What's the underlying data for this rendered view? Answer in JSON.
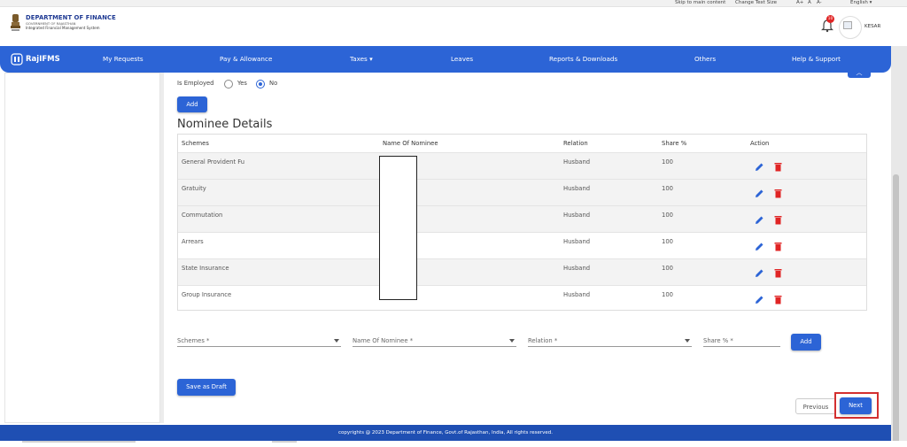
{
  "topbar": {
    "skip": "Skip to main content",
    "text_size": "Change Text Size",
    "a_plus": "A+",
    "a": "A",
    "a_minus": "A-",
    "language": "English"
  },
  "header": {
    "dept_title": "DEPARTMENT OF FINANCE",
    "dept_sub": "GOVERNMENT OF RAJASTHAN",
    "system_name": "Integrated Financial Management System",
    "notification_count": "10",
    "user_name": "KESAR"
  },
  "nav": {
    "brand": "RajIFMS",
    "items": [
      "My Requests",
      "Pay & Allowance",
      "Taxes",
      "Leaves",
      "Reports & Downloads",
      "Others",
      "Help & Support"
    ]
  },
  "form": {
    "employed_label": "Is Employed",
    "yes": "Yes",
    "no": "No",
    "add_label": "Add",
    "section_title": "Nominee Details"
  },
  "table": {
    "headers": [
      "Schemes",
      "Name Of Nominee",
      "Relation",
      "Share %",
      "Action"
    ],
    "rows": [
      {
        "scheme": "General Provident Fu",
        "relation": "Husband",
        "share": "100"
      },
      {
        "scheme": "Gratuity",
        "relation": "Husband",
        "share": "100"
      },
      {
        "scheme": "Commutation",
        "relation": "Husband",
        "share": "100"
      },
      {
        "scheme": "Arrears",
        "relation": "Husband",
        "share": "100"
      },
      {
        "scheme": "State Insurance",
        "relation": "Husband",
        "share": "100"
      },
      {
        "scheme": "Group Insurance",
        "relation": "Husband",
        "share": "100"
      }
    ]
  },
  "entry": {
    "schemes_placeholder": "Schemes *",
    "nominee_placeholder": "Name Of Nominee *",
    "relation_placeholder": "Relation *",
    "share_placeholder": "Share % *",
    "add_label": "Add"
  },
  "actions": {
    "save_draft": "Save as Draft",
    "previous": "Previous",
    "next": "Next"
  },
  "footer": {
    "text": "copyrights @ 2023 Department of Finance, Govt.of Rajasthan, India, All rights reserved."
  },
  "colors": {
    "primary": "#2c64d6",
    "delete": "#e02424",
    "highlight": "#d32f2f"
  }
}
